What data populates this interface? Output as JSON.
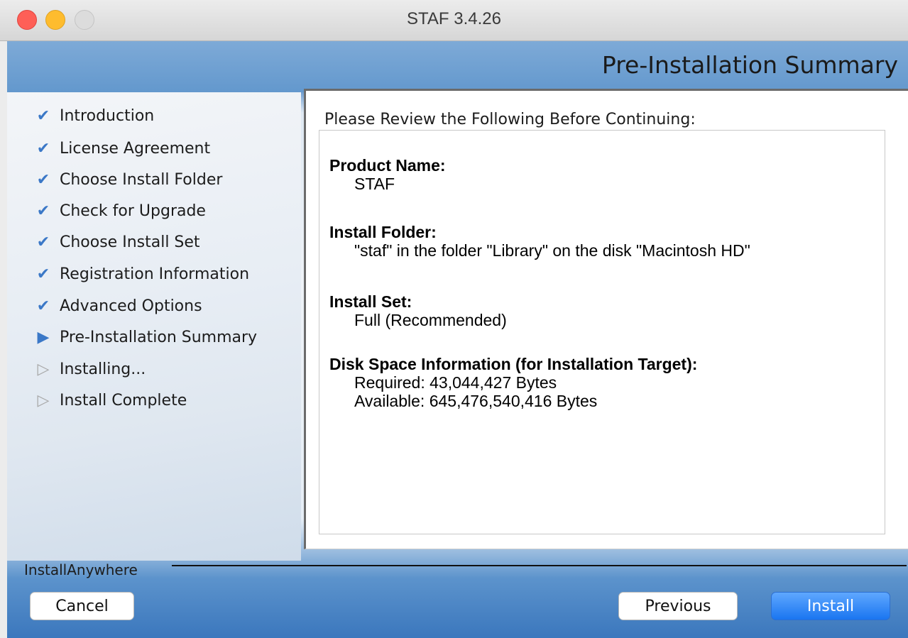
{
  "window": {
    "title": "STAF 3.4.26"
  },
  "header": {
    "title": "Pre-Installation Summary"
  },
  "steps": [
    {
      "label": "Introduction",
      "state": "done",
      "icon": "checkmark-icon"
    },
    {
      "label": "License Agreement",
      "state": "done",
      "icon": "checkmark-icon"
    },
    {
      "label": "Choose Install Folder",
      "state": "done",
      "icon": "checkmark-icon"
    },
    {
      "label": "Check for Upgrade",
      "state": "done",
      "icon": "checkmark-icon"
    },
    {
      "label": "Choose Install Set",
      "state": "done",
      "icon": "checkmark-icon"
    },
    {
      "label": "Registration Information",
      "state": "done",
      "icon": "checkmark-icon"
    },
    {
      "label": "Advanced Options",
      "state": "done",
      "icon": "checkmark-icon"
    },
    {
      "label": "Pre-Installation Summary",
      "state": "current",
      "icon": "filled-triangle-icon"
    },
    {
      "label": "Installing...",
      "state": "pending",
      "icon": "outline-triangle-icon"
    },
    {
      "label": "Install Complete",
      "state": "pending",
      "icon": "outline-triangle-icon"
    }
  ],
  "summary": {
    "heading": "Please Review the Following Before Continuing:",
    "product_name": {
      "label": "Product Name:",
      "value": "STAF"
    },
    "install_folder": {
      "label": "Install Folder:",
      "value": "\"staf\" in the folder \"Library\" on the disk \"Macintosh HD\""
    },
    "install_set": {
      "label": "Install Set:",
      "value": "Full (Recommended)"
    },
    "disk_space": {
      "label": "Disk Space Information (for Installation Target):",
      "required": "Required: 43,044,427 Bytes",
      "available": "Available: 645,476,540,416 Bytes"
    }
  },
  "footer": {
    "brand": "InstallAnywhere",
    "cancel_label": "Cancel",
    "previous_label": "Previous",
    "install_label": "Install"
  },
  "colors": {
    "accent": "#3b78c7",
    "primary_button": "#1a75f0",
    "header_band": "#6398cd"
  }
}
